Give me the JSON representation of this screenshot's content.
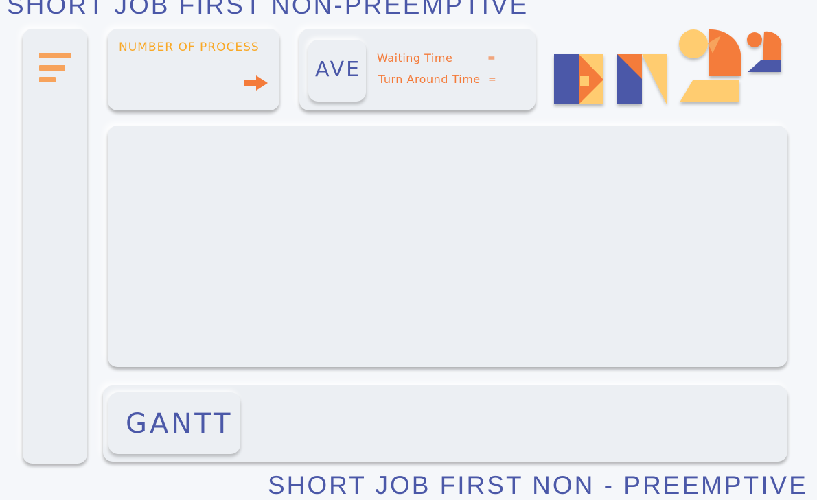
{
  "header": {
    "title": "SHORT JOB FIRST NON-PREEMPTIVE"
  },
  "footer": {
    "title": "SHORT  JOB FIRST NON - PREEMPTIVE"
  },
  "sidebar": {
    "menu_icon": "menu-bars-icon"
  },
  "process_input": {
    "label": "NUMBER OF PROCESS",
    "value": "",
    "submit_icon": "arrow-right-icon"
  },
  "averages": {
    "badge": "AVE",
    "waiting_time_label": "Waiting Time",
    "waiting_time_eq": "=",
    "waiting_time_value": "",
    "turnaround_time_label": "Turn Around Time",
    "turnaround_time_eq": "=",
    "turnaround_time_value": ""
  },
  "gantt": {
    "label": "GANTT"
  },
  "colors": {
    "primary_blue": "#4b58a8",
    "orange": "#f47b3a",
    "amber": "#f9a825",
    "yellow": "#ffcc70",
    "panel": "#eceff3",
    "background": "#f5f7fa"
  }
}
